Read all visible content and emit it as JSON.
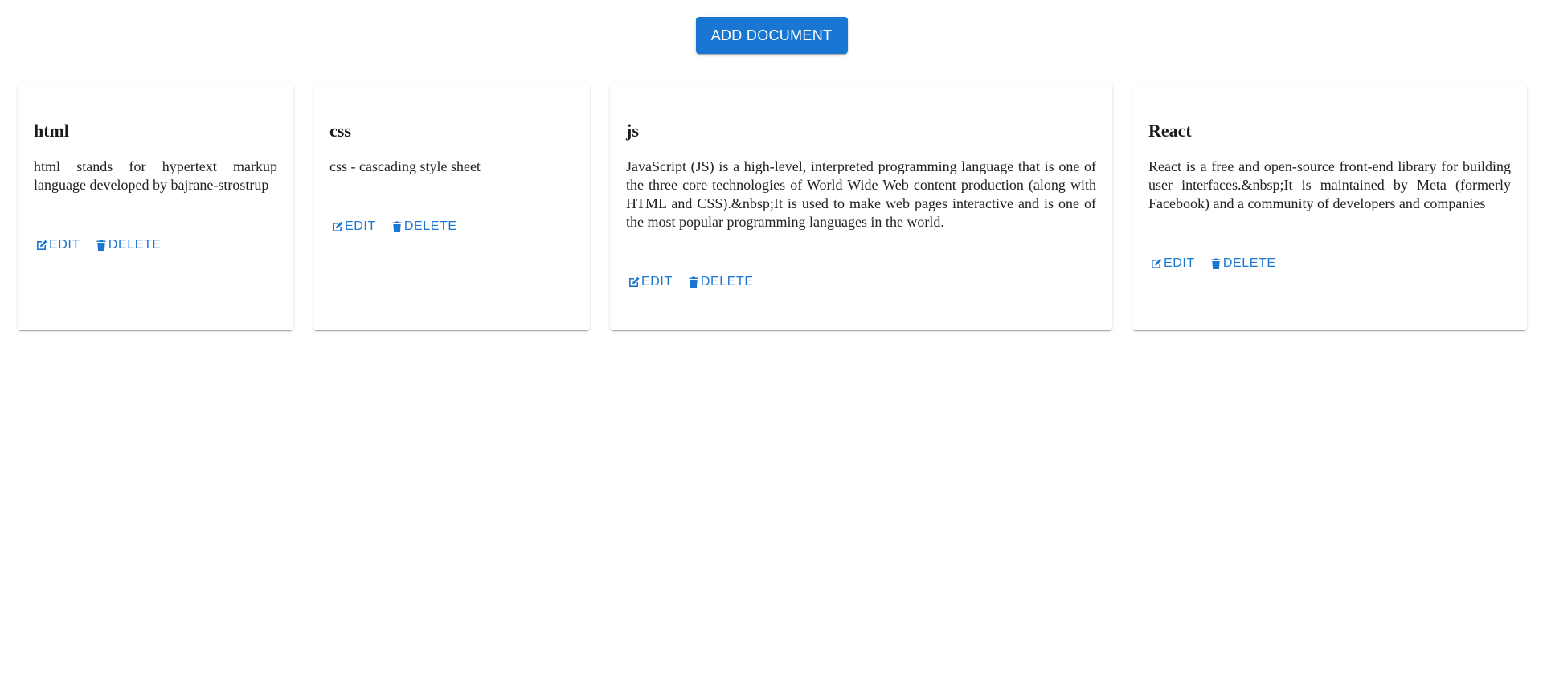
{
  "toolbar": {
    "add_label": "ADD DOCUMENT"
  },
  "documents": [
    {
      "title": "html",
      "description": "html stands for hypertext markup language developed by bajrane-strostrup",
      "edit_label": "EDIT",
      "delete_label": "DELETE"
    },
    {
      "title": "css",
      "description": "css - cascading style sheet",
      "edit_label": "EDIT",
      "delete_label": "DELETE"
    },
    {
      "title": "js",
      "description": "JavaScript (JS) is a high-level, interpreted programming language that is one of the three core technologies of World Wide Web content production (along with HTML and CSS).&nbsp;It is used to make web pages interactive and is one of the most popular programming languages in the world.",
      "edit_label": "EDIT",
      "delete_label": "DELETE"
    },
    {
      "title": "React",
      "description": "React is a free and open-source front-end library for building user interfaces.&nbsp;It is maintained by Meta (formerly Facebook) and a community of developers and companies",
      "edit_label": "EDIT",
      "delete_label": "DELETE"
    }
  ],
  "icons": {
    "edit": "edit-icon",
    "delete": "trash-icon"
  },
  "colors": {
    "primary": "#1976d2",
    "text": "#222222",
    "background": "#ffffff"
  }
}
